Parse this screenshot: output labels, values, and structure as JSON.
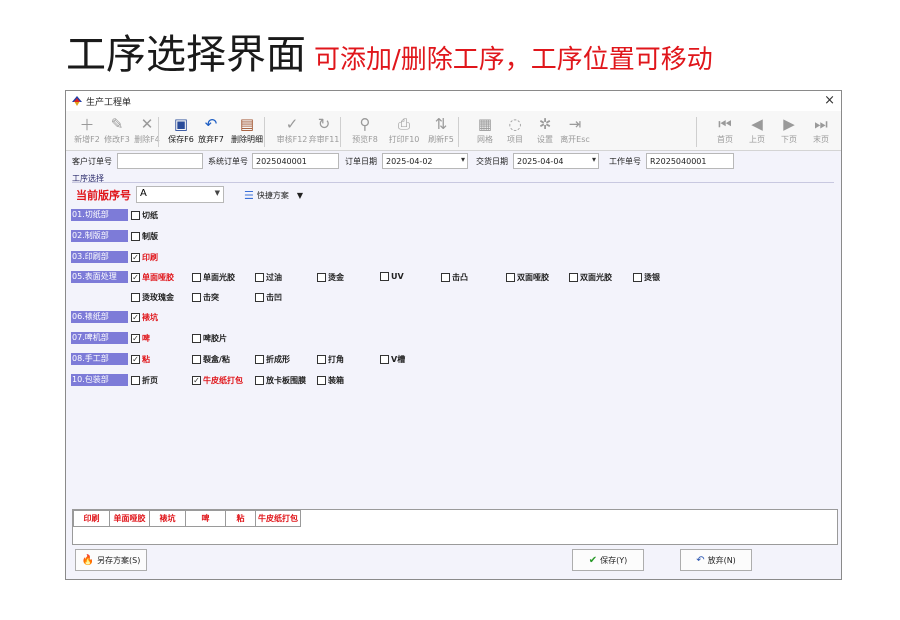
{
  "header": {
    "title": "工序选择界面",
    "subtitle": "可添加/删除工序，工序位置可移动"
  },
  "window": {
    "title": "生产工程单",
    "close": "×"
  },
  "toolbar": [
    {
      "label": "新增F2",
      "icon": "＋",
      "enabled": false
    },
    {
      "label": "修改F3",
      "icon": "✎",
      "enabled": false
    },
    {
      "label": "删除F4",
      "icon": "✕",
      "enabled": false
    },
    {
      "label": "保存F6",
      "icon": "▣",
      "enabled": true
    },
    {
      "label": "放弃F7",
      "icon": "↶",
      "enabled": true
    },
    {
      "label": "删除明细",
      "icon": "▤",
      "enabled": true
    },
    {
      "label": "审核F12",
      "icon": "✓",
      "enabled": false
    },
    {
      "label": "弃审F11",
      "icon": "↻",
      "enabled": false
    },
    {
      "label": "预览F8",
      "icon": "⚲",
      "enabled": false
    },
    {
      "label": "打印F10",
      "icon": "⎙",
      "enabled": false
    },
    {
      "label": "刷新F5",
      "icon": "⇅",
      "enabled": false
    },
    {
      "label": "网格",
      "icon": "▦",
      "enabled": false
    },
    {
      "label": "项目",
      "icon": "◌",
      "enabled": false
    },
    {
      "label": "设置",
      "icon": "✲",
      "enabled": false
    },
    {
      "label": "离开Esc",
      "icon": "⇥",
      "enabled": false
    },
    {
      "label": "首页",
      "icon": "⏮",
      "enabled": false
    },
    {
      "label": "上页",
      "icon": "◀",
      "enabled": false
    },
    {
      "label": "下页",
      "icon": "▶",
      "enabled": false
    },
    {
      "label": "末页",
      "icon": "⏭",
      "enabled": false
    }
  ],
  "info": {
    "customer_order_label": "客户订单号",
    "customer_order_value": "",
    "system_order_label": "系统订单号",
    "system_order_value": "2025040001",
    "order_date_label": "订单日期",
    "order_date_value": "2025-04-02",
    "delivery_date_label": "交货日期",
    "delivery_date_value": "2025-04-04",
    "work_order_label": "工作单号",
    "work_order_value": "R2025040001"
  },
  "section_title": "工序选择",
  "current_version": {
    "label": "当前版序号",
    "value": "A"
  },
  "quick_plan": "快捷方案",
  "departments": [
    {
      "name": "01.切纸部",
      "options": [
        {
          "label": "切纸",
          "checked": false,
          "red": false
        }
      ]
    },
    {
      "name": "02.制版部",
      "options": [
        {
          "label": "制版",
          "checked": false,
          "red": false
        }
      ]
    },
    {
      "name": "03.印刷部",
      "options": [
        {
          "label": "印刷",
          "checked": true,
          "red": true
        }
      ]
    },
    {
      "name": "05.表面处理",
      "options": [
        {
          "label": "单面哑胶",
          "checked": true,
          "red": true
        },
        {
          "label": "单面光胶",
          "checked": false,
          "red": false
        },
        {
          "label": "过油",
          "checked": false,
          "red": false
        },
        {
          "label": "烫金",
          "checked": false,
          "red": false
        },
        {
          "label": "UV",
          "checked": false,
          "red": false
        },
        {
          "label": "击凸",
          "checked": false,
          "red": false
        },
        {
          "label": "双面哑胶",
          "checked": false,
          "red": false
        },
        {
          "label": "双面光胶",
          "checked": false,
          "red": false
        },
        {
          "label": "烫银",
          "checked": false,
          "red": false
        },
        {
          "label": "烫玫瑰金",
          "checked": false,
          "red": false
        },
        {
          "label": "击突",
          "checked": false,
          "red": false
        },
        {
          "label": "击凹",
          "checked": false,
          "red": false
        }
      ]
    },
    {
      "name": "06.裱纸部",
      "options": [
        {
          "label": "裱坑",
          "checked": true,
          "red": true
        }
      ]
    },
    {
      "name": "07.啤机部",
      "options": [
        {
          "label": "啤",
          "checked": true,
          "red": true
        },
        {
          "label": "啤胶片",
          "checked": false,
          "red": false
        }
      ]
    },
    {
      "name": "08.手工部",
      "options": [
        {
          "label": "粘",
          "checked": true,
          "red": true
        },
        {
          "label": "裂盒/粘",
          "checked": false,
          "red": false
        },
        {
          "label": "折成形",
          "checked": false,
          "red": false
        },
        {
          "label": "打角",
          "checked": false,
          "red": false
        },
        {
          "label": "V槽",
          "checked": false,
          "red": false
        }
      ]
    },
    {
      "name": "10.包装部",
      "options": [
        {
          "label": "折页",
          "checked": false,
          "red": false
        },
        {
          "label": "牛皮纸打包",
          "checked": true,
          "red": true
        },
        {
          "label": "放卡板围膜",
          "checked": false,
          "red": false
        },
        {
          "label": "装箱",
          "checked": false,
          "red": false
        }
      ]
    }
  ],
  "selected_processes": [
    "印刷",
    "单面哑胶",
    "裱坑",
    "啤",
    "粘",
    "牛皮纸打包"
  ],
  "buttons": {
    "save_as": "另存方案(S)",
    "save": "保存(Y)",
    "cancel": "放弃(N)"
  },
  "colors": {
    "accent_red": "#e0161b",
    "dept_bg": "#7d7bd8",
    "window_bg": "#f3f3fb"
  }
}
